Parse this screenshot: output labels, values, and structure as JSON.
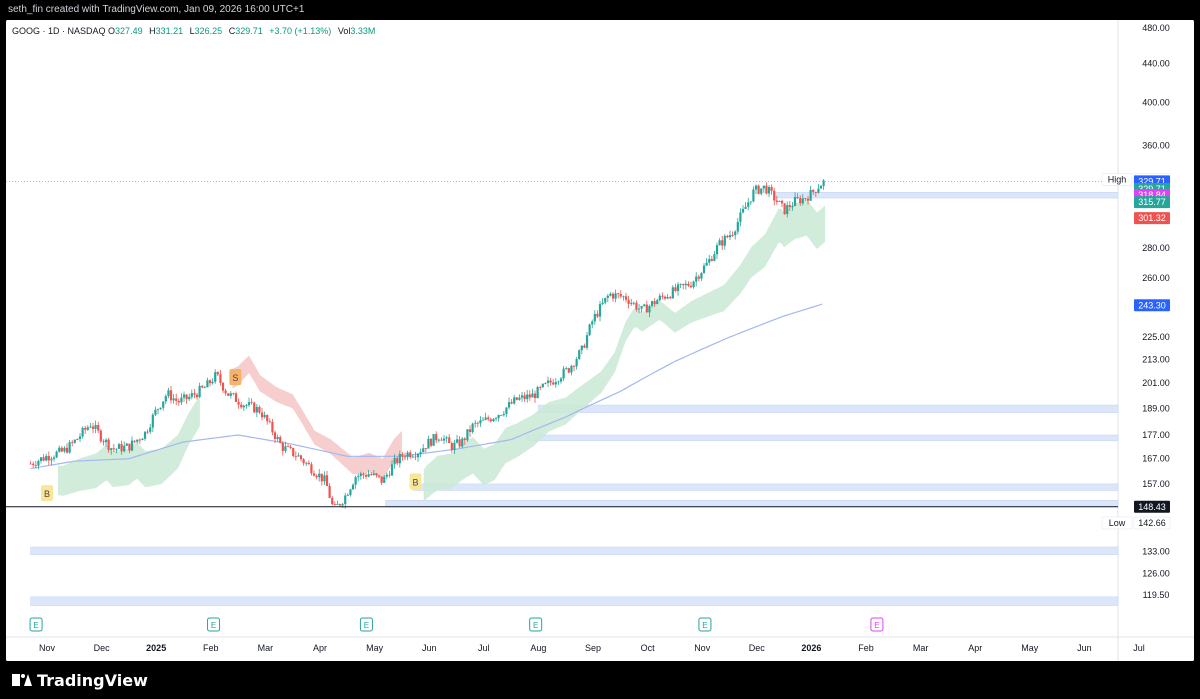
{
  "header": {
    "credit": "seth_fin created with TradingView.com, Jan 09, 2026 16:00 UTC+1"
  },
  "legend": {
    "symbol": "GOOG · 1D · NASDAQ",
    "open_label": "O",
    "open": "327.49",
    "high_label": "H",
    "high": "331.21",
    "low_label": "L",
    "low": "326.25",
    "close_label": "C",
    "close": "329.71",
    "change": "+3.70 (+1.13%)",
    "volume_label": "Vol",
    "volume": "3.33M"
  },
  "footer": {
    "brand": "TradingView"
  },
  "colors": {
    "up": "#26a69a",
    "down": "#ef5350",
    "sma": "#a3b8ef",
    "zone": "#dbe6fa",
    "green_band": "#c9e9d3",
    "red_band": "#f6c6c6",
    "price_blue": "#2962ff",
    "price_green": "#26a69a",
    "price_magenta": "#e040fb",
    "price_red": "#ef5350"
  },
  "chart_data": {
    "type": "candlestick",
    "symbol": "GOOG",
    "timeframe": "1D",
    "x_tick_labels": [
      "Nov",
      "Dec",
      "2025",
      "Feb",
      "Mar",
      "Apr",
      "May",
      "Jun",
      "Jul",
      "Aug",
      "Sep",
      "Oct",
      "Nov",
      "Dec",
      "2026",
      "Feb",
      "Mar",
      "Apr",
      "May",
      "Jun",
      "Jul"
    ],
    "y_axis": {
      "scale": "log",
      "ylim": [
        113,
        485
      ],
      "tick_labels": [
        "480.00",
        "440.00",
        "400.00",
        "360.00",
        "280.00",
        "260.00",
        "225.00",
        "213.00",
        "201.00",
        "189.00",
        "177.00",
        "167.00",
        "157.00",
        "133.00",
        "126.00",
        "119.50"
      ]
    },
    "price_labels": [
      {
        "text": "High",
        "value": "331.21",
        "price": 331.21,
        "kind": "plain"
      },
      {
        "text": "",
        "value": "329.71",
        "price": 329.71,
        "kind": "blue"
      },
      {
        "text": "",
        "value": "329.71",
        "sub": "05:59:54",
        "price": 323.6,
        "kind": "green"
      },
      {
        "text": "",
        "value": "318.84",
        "price": 318.84,
        "kind": "magenta"
      },
      {
        "text": "",
        "value": "315.77",
        "price": 313.3,
        "kind": "green"
      },
      {
        "text": "",
        "value": "301.32",
        "price": 301.32,
        "kind": "red"
      },
      {
        "text": "",
        "value": "243.30",
        "price": 243.3,
        "kind": "blue"
      },
      {
        "text": "",
        "value": "148.43",
        "price": 148.43,
        "kind": "black"
      },
      {
        "text": "Low",
        "value": "142.66",
        "price": 142.66,
        "kind": "plain"
      }
    ],
    "horizontal_lines": [
      {
        "price": 148.43
      }
    ],
    "zones": [
      {
        "from": 316.5,
        "to": 321.0,
        "start_month": 13.35
      },
      {
        "from": 187.0,
        "to": 190.5,
        "start_month": 9.0
      },
      {
        "from": 174.5,
        "to": 177.0,
        "start_month": 8.8
      },
      {
        "from": 154.5,
        "to": 157.0,
        "start_month": 6.7
      },
      {
        "from": 148.6,
        "to": 150.8,
        "start_month": 6.2
      },
      {
        "from": 132.0,
        "to": 134.5,
        "start_month": -0.3
      },
      {
        "from": 116.5,
        "to": 119.0,
        "start_month": -0.3
      }
    ],
    "signals": [
      {
        "label": "B",
        "month": 0.0,
        "price": 153.5,
        "color": "#f7e79a"
      },
      {
        "label": "S",
        "month": 3.45,
        "price": 204.0,
        "color": "#f5b26b"
      },
      {
        "label": "B",
        "month": 6.75,
        "price": 158.0,
        "color": "#f7e79a"
      }
    ],
    "earnings_markers": [
      {
        "label": "E",
        "month": -0.2,
        "color": "#26a69a"
      },
      {
        "label": "E",
        "month": 3.05,
        "color": "#26a69a"
      },
      {
        "label": "E",
        "month": 5.85,
        "color": "#26a69a"
      },
      {
        "label": "E",
        "month": 8.95,
        "color": "#26a69a"
      },
      {
        "label": "E",
        "month": 12.05,
        "color": "#26a69a"
      },
      {
        "label": "E",
        "month": 15.2,
        "color": "#e040fb"
      }
    ],
    "price_path": [
      [
        -0.3,
        165
      ],
      [
        0.0,
        168
      ],
      [
        0.3,
        170
      ],
      [
        0.5,
        174
      ],
      [
        0.8,
        182
      ],
      [
        1.0,
        176
      ],
      [
        1.2,
        171
      ],
      [
        1.5,
        172
      ],
      [
        1.8,
        178
      ],
      [
        2.0,
        188
      ],
      [
        2.2,
        196
      ],
      [
        2.4,
        192
      ],
      [
        2.6,
        194
      ],
      [
        2.9,
        199
      ],
      [
        3.1,
        205
      ],
      [
        3.3,
        196
      ],
      [
        3.6,
        191
      ],
      [
        3.9,
        188
      ],
      [
        4.1,
        180
      ],
      [
        4.3,
        172
      ],
      [
        4.6,
        168
      ],
      [
        4.9,
        162
      ],
      [
        5.1,
        158
      ],
      [
        5.25,
        147
      ],
      [
        5.45,
        152
      ],
      [
        5.65,
        160
      ],
      [
        5.9,
        161
      ],
      [
        6.15,
        158
      ],
      [
        6.35,
        165
      ],
      [
        6.55,
        169
      ],
      [
        6.8,
        170
      ],
      [
        7.0,
        174
      ],
      [
        7.2,
        177
      ],
      [
        7.4,
        172
      ],
      [
        7.6,
        174
      ],
      [
        7.8,
        181
      ],
      [
        8.0,
        183
      ],
      [
        8.3,
        187
      ],
      [
        8.6,
        193
      ],
      [
        8.9,
        195
      ],
      [
        9.1,
        199
      ],
      [
        9.3,
        203
      ],
      [
        9.55,
        208
      ],
      [
        9.8,
        218
      ],
      [
        10.0,
        235
      ],
      [
        10.3,
        250
      ],
      [
        10.6,
        248
      ],
      [
        10.9,
        240
      ],
      [
        11.2,
        247
      ],
      [
        11.5,
        252
      ],
      [
        11.8,
        257
      ],
      [
        12.1,
        270
      ],
      [
        12.3,
        282
      ],
      [
        12.55,
        291
      ],
      [
        12.75,
        306
      ],
      [
        12.95,
        322
      ],
      [
        13.15,
        325
      ],
      [
        13.35,
        315
      ],
      [
        13.5,
        307
      ],
      [
        13.7,
        314
      ],
      [
        13.85,
        316
      ],
      [
        14.0,
        320
      ],
      [
        14.15,
        327
      ],
      [
        14.25,
        329.71
      ]
    ],
    "sma_path": [
      [
        -0.3,
        163
      ],
      [
        0.5,
        166
      ],
      [
        1.5,
        167
      ],
      [
        2.5,
        174
      ],
      [
        3.5,
        177
      ],
      [
        4.5,
        173
      ],
      [
        5.5,
        168
      ],
      [
        6.5,
        168
      ],
      [
        7.5,
        171
      ],
      [
        8.5,
        175
      ],
      [
        9.5,
        185
      ],
      [
        10.5,
        197
      ],
      [
        11.5,
        212
      ],
      [
        12.5,
        225
      ],
      [
        13.5,
        237
      ],
      [
        14.2,
        244
      ]
    ],
    "green_band_segments": [
      [
        0.2,
        2.8
      ],
      [
        6.9,
        14.25
      ]
    ],
    "red_band_segment": [
      3.4,
      6.5
    ]
  }
}
